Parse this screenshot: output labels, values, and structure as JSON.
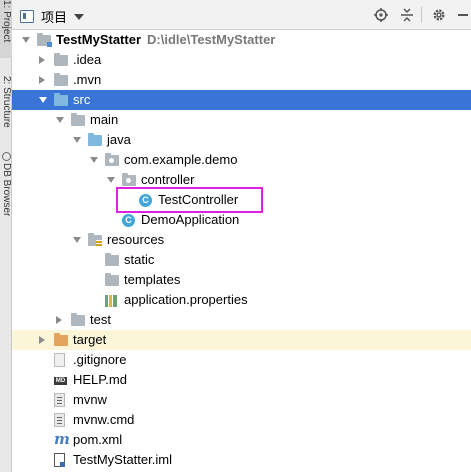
{
  "side_tabs": [
    "1: Project",
    "2: Structure",
    "DB Browser"
  ],
  "header": {
    "title": "项目"
  },
  "tree": [
    {
      "indent": 0,
      "arrow": "down",
      "icon": "folder-module",
      "label": "TestMyStatter",
      "bold": true,
      "path": "D:\\idle\\TestMyStatter"
    },
    {
      "indent": 1,
      "arrow": "right",
      "icon": "folder",
      "label": ".idea"
    },
    {
      "indent": 1,
      "arrow": "right",
      "icon": "folder",
      "label": ".mvn"
    },
    {
      "indent": 1,
      "arrow": "down",
      "icon": "folder-source",
      "label": "src",
      "selected": true
    },
    {
      "indent": 2,
      "arrow": "down",
      "icon": "folder",
      "label": "main"
    },
    {
      "indent": 3,
      "arrow": "down",
      "icon": "folder-source",
      "label": "java"
    },
    {
      "indent": 4,
      "arrow": "down",
      "icon": "package",
      "label": "com.example.demo"
    },
    {
      "indent": 5,
      "arrow": "down",
      "icon": "package",
      "label": "controller"
    },
    {
      "indent": 6,
      "arrow": null,
      "icon": "class",
      "label": "TestController"
    },
    {
      "indent": 5,
      "arrow": null,
      "icon": "class",
      "label": "DemoApplication"
    },
    {
      "indent": 3,
      "arrow": "down",
      "icon": "folder-resources",
      "label": "resources"
    },
    {
      "indent": 4,
      "arrow": null,
      "icon": "folder",
      "label": "static"
    },
    {
      "indent": 4,
      "arrow": null,
      "icon": "folder",
      "label": "templates"
    },
    {
      "indent": 4,
      "arrow": null,
      "icon": "properties",
      "label": "application.properties"
    },
    {
      "indent": 2,
      "arrow": "right",
      "icon": "folder",
      "label": "test"
    },
    {
      "indent": 1,
      "arrow": "right",
      "icon": "folder-excluded",
      "label": "target",
      "highlight": true
    },
    {
      "indent": 1,
      "arrow": null,
      "icon": "gitignore",
      "label": ".gitignore"
    },
    {
      "indent": 1,
      "arrow": null,
      "icon": "markdown",
      "label": "HELP.md"
    },
    {
      "indent": 1,
      "arrow": null,
      "icon": "file",
      "label": "mvnw"
    },
    {
      "indent": 1,
      "arrow": null,
      "icon": "file",
      "label": "mvnw.cmd"
    },
    {
      "indent": 1,
      "arrow": null,
      "icon": "maven",
      "label": "pom.xml"
    },
    {
      "indent": 1,
      "arrow": null,
      "icon": "iml",
      "label": "TestMyStatter.iml"
    }
  ],
  "colors": {
    "selection": "#3875d7",
    "highlight_box": "#e020e0",
    "excluded_row": "#fbf6d8"
  }
}
